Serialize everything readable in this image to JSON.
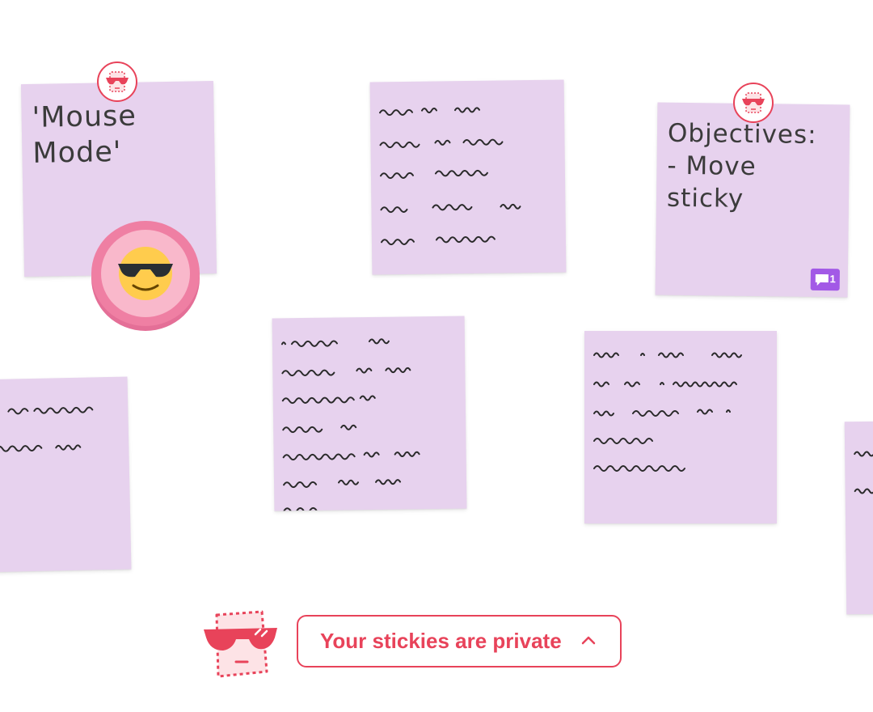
{
  "stickies": {
    "mouse_mode": {
      "text": "'Mouse\nMode'"
    },
    "objectives": {
      "text": "Objectives:\n- Move\nsticky"
    }
  },
  "comment_badge": {
    "count": "1"
  },
  "privacy_button": {
    "label": "Your stickies are private"
  },
  "icons": {
    "owner_avatar": "sunglasses-sticky-icon",
    "cursor_emoji": "cool-sunglasses-emoji",
    "comment": "comment-icon",
    "chevron": "chevron-up-icon",
    "mascot": "sunglasses-sticky-mascot"
  },
  "colors": {
    "sticky": "#e7d2ee",
    "accent": "#e8435a",
    "comment_badge": "#a259e6",
    "cursor_ring": "#ef7fa3"
  }
}
